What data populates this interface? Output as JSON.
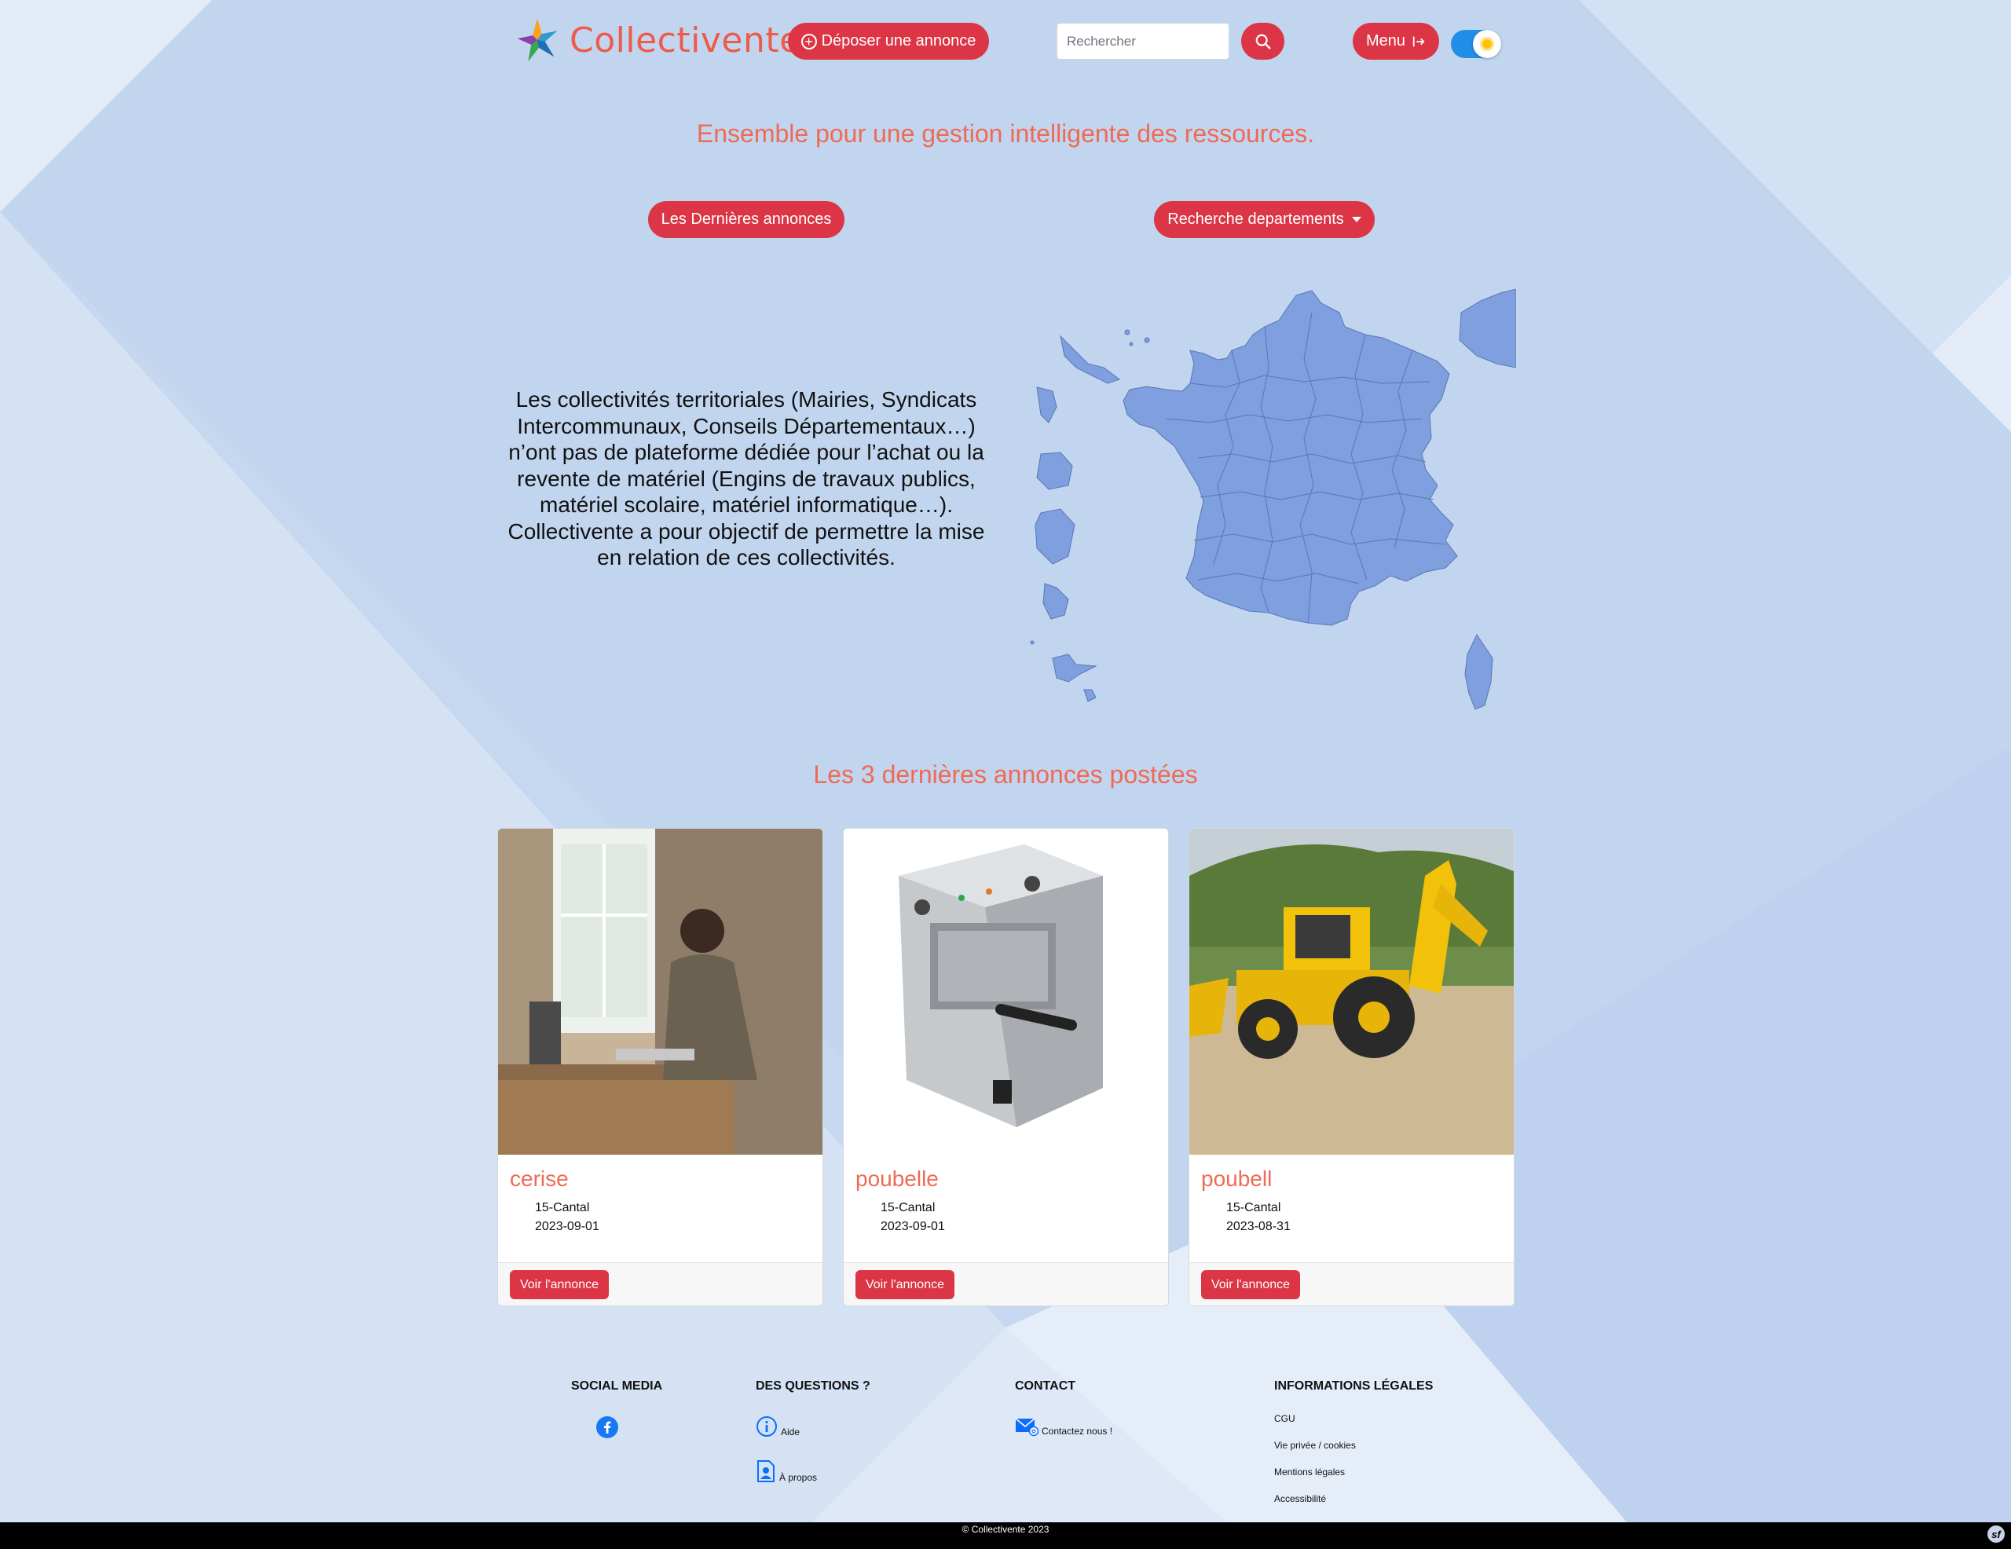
{
  "header": {
    "brand": "Collectivente",
    "deposit_label": "Déposer une annonce",
    "search_placeholder": "Rechercher",
    "menu_label": "Menu"
  },
  "hero": {
    "tagline": "Ensemble pour une gestion intelligente des ressources.",
    "latest_button": "Les Dernières annonces",
    "departments_button": "Recherche departements",
    "intro": "Les collectivités territoriales (Mairies, Syndicats Intercommunaux, Conseils Départementaux…) n’ont pas de plateforme dédiée pour l’achat ou la revente de matériel (Engins de travaux publics, matériel scolaire, matériel informatique…). Collectivente a pour objectif de permettre la mise en relation de ces collectivités."
  },
  "latest": {
    "title": "Les 3 dernières annonces postées",
    "cards": [
      {
        "title": "cerise",
        "location": "15-Cantal",
        "date": "2023-09-01",
        "button": "Voir l'annonce"
      },
      {
        "title": "poubelle",
        "location": "15-Cantal",
        "date": "2023-09-01",
        "button": "Voir l'annonce"
      },
      {
        "title": "poubell",
        "location": "15-Cantal",
        "date": "2023-08-31",
        "button": "Voir l'annonce"
      }
    ]
  },
  "footer": {
    "social_title": "SOCIAL MEDIA",
    "questions_title": "DES QUESTIONS ?",
    "help": "Aide",
    "about": "À propos",
    "contact_title": "CONTACT",
    "contact_link": "Contactez nous !",
    "legal_title": "INFORMATIONS LÉGALES",
    "legal_links": [
      "CGU",
      "Vie privée / cookies",
      "Mentions légales",
      "Accessibilité"
    ],
    "copyright": "© Collectivente 2023"
  },
  "colors": {
    "accent": "#dc3545",
    "brand_text": "#ef5a4a",
    "map_fill": "#7f9fde"
  }
}
